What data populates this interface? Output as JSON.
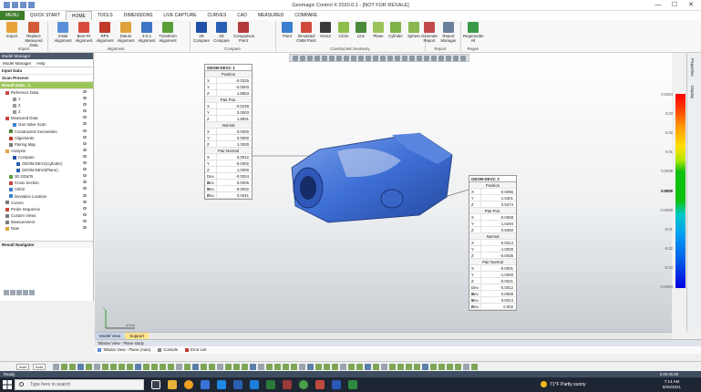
{
  "window": {
    "title": "Geomagic Control X 2020.0.1 - [NOT FOR RESALE]",
    "minimize": "—",
    "maximize": "☐",
    "close": "✕"
  },
  "ribbon_tabs": [
    {
      "label": "MENU"
    },
    {
      "label": "QUICK START"
    },
    {
      "label": "HOME"
    },
    {
      "label": "TOOLS"
    },
    {
      "label": "DIMENSIONS"
    },
    {
      "label": "LIVE CAPTURE"
    },
    {
      "label": "CURVES"
    },
    {
      "label": "CAD"
    },
    {
      "label": "MEASURED"
    },
    {
      "label": "COMPARE"
    }
  ],
  "ribbon": {
    "import": {
      "buttons": [
        {
          "label": "Import",
          "color": "#e8a23a"
        },
        {
          "label": "Replace Measured Data",
          "color": "#d25a3a"
        }
      ],
      "group": "Import"
    },
    "alignment": {
      "buttons": [
        {
          "label": "Initial Alignment",
          "color": "#5a8fd8"
        },
        {
          "label": "Best-Fit Alignment",
          "color": "#d94c3d"
        },
        {
          "label": "RPS Alignment",
          "color": "#c0392b"
        },
        {
          "label": "Datum Alignment",
          "color": "#e0a33a"
        },
        {
          "label": "3-2-1 Alignment",
          "color": "#3e74c4"
        },
        {
          "label": "Transform Alignment",
          "color": "#5a9e3a"
        }
      ],
      "group": "Alignment"
    },
    "compare": {
      "buttons": [
        {
          "label": "3D Compare",
          "color": "#1f4fa8"
        },
        {
          "label": "2D Compare",
          "color": "#2b5fb3"
        },
        {
          "label": "Comparison Point",
          "color": "#b33b3b"
        }
      ],
      "group": "Compare"
    },
    "geometry": {
      "buttons": [
        {
          "label": "Point",
          "color": "#3a7fd0"
        },
        {
          "label": "Simulated CMM Point",
          "color": "#d04a3a"
        },
        {
          "label": "Vector",
          "color": "#3a3a3a"
        },
        {
          "label": "Circle",
          "color": "#8fbf4a"
        },
        {
          "label": "Line",
          "color": "#4a8a3a"
        },
        {
          "label": "Plane",
          "color": "#9bc25a"
        },
        {
          "label": "Cylinder",
          "color": "#7fb247"
        },
        {
          "label": "Sphere",
          "color": "#88b84e"
        }
      ],
      "group": "Constructed Geometry"
    },
    "report": {
      "buttons": [
        {
          "label": "Generate Report",
          "color": "#c24a4a"
        },
        {
          "label": "Report Manager",
          "color": "#6a7f9a"
        }
      ],
      "group": "Report"
    },
    "regen": {
      "buttons": [
        {
          "label": "Regenerate All",
          "color": "#3a9a4a"
        }
      ],
      "group": "Regen"
    }
  },
  "panel": {
    "title": "Model Manager",
    "tabs": [
      "Model Manager",
      "Help"
    ],
    "sections": {
      "input": "Input Data",
      "scan": "Scan Process",
      "result": "Result Data - 1"
    },
    "tree": [
      {
        "label": "Reference Data",
        "indent": 1,
        "color": "#c44"
      },
      {
        "label": "1",
        "indent": 3,
        "color": "#999"
      },
      {
        "label": "2",
        "indent": 3,
        "color": "#999"
      },
      {
        "label": "3",
        "indent": 3,
        "color": "#999"
      },
      {
        "label": "Measured Data",
        "indent": 1,
        "color": "#c44"
      },
      {
        "label": "Gas Valve Scan",
        "indent": 3,
        "color": "#3a7fd0"
      },
      {
        "label": "Constructed Geometries",
        "indent": 2,
        "color": "#4a8a3a"
      },
      {
        "label": "Alignments",
        "indent": 2,
        "color": "#c0392b"
      },
      {
        "label": "Pairing Map",
        "indent": 2,
        "color": "#7a7a7a"
      },
      {
        "label": "Analysis",
        "indent": 1,
        "color": "#e0a33a"
      },
      {
        "label": "Compare",
        "indent": 3,
        "color": "#1f4fa8"
      },
      {
        "label": "GEOM-DEV1(Cylinder)",
        "indent": 4,
        "color": "#2b5fb3"
      },
      {
        "label": "GEOM-DEV2(Plane)",
        "indent": 4,
        "color": "#2b5fb3"
      },
      {
        "label": "3D GD&Ts",
        "indent": 2,
        "color": "#5a9e3a"
      },
      {
        "label": "Cross Section",
        "indent": 2,
        "color": "#c44"
      },
      {
        "label": "Airfoil",
        "indent": 2,
        "color": "#3a7fd0"
      },
      {
        "label": "Deviation Location",
        "indent": 2,
        "color": "#3a7fd0"
      },
      {
        "label": "Curves",
        "indent": 1,
        "color": "#7a7a7a"
      },
      {
        "label": "Probe Sequence",
        "indent": 1,
        "color": "#d04a3a"
      },
      {
        "label": "Custom Views",
        "indent": 1,
        "color": "#7a7a7a"
      },
      {
        "label": "Measurement",
        "indent": 1,
        "color": "#7a7a7a"
      },
      {
        "label": "Note",
        "indent": 1,
        "color": "#e0a33a"
      }
    ],
    "navigator": "Result Navigator"
  },
  "callout1": {
    "title": "GEOM-DEV2: 1",
    "rows": [
      {
        "k": "",
        "v": "Position",
        "sub": true
      },
      {
        "k": "X",
        "v": "-0.0225"
      },
      {
        "k": "Y",
        "v": "-0.0003"
      },
      {
        "k": "Z",
        "v": "1.8853"
      },
      {
        "k": "",
        "v": "Pair Pos.",
        "sub": true
      },
      {
        "k": "X",
        "v": "-0.0249"
      },
      {
        "k": "Y",
        "v": "0.0003"
      },
      {
        "k": "Z",
        "v": "1.8831"
      },
      {
        "k": "",
        "v": "Normal",
        "sub": true
      },
      {
        "k": "X",
        "v": "0.0000"
      },
      {
        "k": "Y",
        "v": "0.0000"
      },
      {
        "k": "Z",
        "v": "1.0000"
      },
      {
        "k": "",
        "v": "Pair Normal",
        "sub": true
      },
      {
        "k": "X",
        "v": "0.0012"
      },
      {
        "k": "Y",
        "v": "-0.0002"
      },
      {
        "k": "Z",
        "v": "1.0000"
      },
      {
        "k": "Dev. X",
        "v": "-0.0024"
      },
      {
        "k": "Dev. Y",
        "v": "0.0006"
      },
      {
        "k": "Dev. Z",
        "v": "-0.0022"
      },
      {
        "k": "Dev.",
        "v": "0.0041"
      }
    ]
  },
  "callout2": {
    "title": "GEOM-DEV2: 2",
    "rows": [
      {
        "k": "",
        "v": "Position",
        "sub": true
      },
      {
        "k": "X",
        "v": "-0.0056"
      },
      {
        "k": "Y",
        "v": "-1.6301"
      },
      {
        "k": "Z",
        "v": "0.5374"
      },
      {
        "k": "",
        "v": "Pair Pos.",
        "sub": true
      },
      {
        "k": "X",
        "v": "-0.0068"
      },
      {
        "k": "Y",
        "v": "-1.6294"
      },
      {
        "k": "Z",
        "v": "0.5360"
      },
      {
        "k": "",
        "v": "Normal",
        "sub": true
      },
      {
        "k": "X",
        "v": "-0.0014"
      },
      {
        "k": "Y",
        "v": "-1.0000"
      },
      {
        "k": "Z",
        "v": "-0.0036"
      },
      {
        "k": "",
        "v": "Pair Normal",
        "sub": true
      },
      {
        "k": "X",
        "v": "-0.0001"
      },
      {
        "k": "Y",
        "v": "-1.0000"
      },
      {
        "k": "Z",
        "v": "-0.0021"
      },
      {
        "k": "Dev. X",
        "v": "-0.0012"
      },
      {
        "k": "Dev. Y",
        "v": "0.0008"
      },
      {
        "k": "Dev. Z",
        "v": "0.0014"
      },
      {
        "k": "Dev.",
        "v": "0.002"
      }
    ]
  },
  "legend": {
    "ticks": [
      "0.0394",
      "0.03",
      "0.02",
      "0.01",
      "0.0039",
      "0.0000",
      "-0.0039",
      "-0.01",
      "-0.02",
      "-0.03",
      "-0.0394"
    ],
    "highlight": "0.0000"
  },
  "scale_label": "1.0 in",
  "axis": {
    "x": "X",
    "y": "Y"
  },
  "viewport_tabs": [
    {
      "label": "Model View"
    },
    {
      "label": "Support"
    }
  ],
  "tabular": {
    "title": "Tabular View - Plane study",
    "items": [
      {
        "label": "Tabular View - Plane (Auto)",
        "color": "#5a8fd8"
      },
      {
        "label": "Console",
        "color": "#888"
      },
      {
        "label": "Error List",
        "color": "#c0392b"
      }
    ]
  },
  "side_tabs": [
    "Properties",
    "Display"
  ],
  "bottom_toolbar": {
    "select1": "Auto",
    "select2": "Auto"
  },
  "status": {
    "left": "Ready",
    "right": "0.00 00.00"
  },
  "taskbar": {
    "search_placeholder": "Type here to search",
    "weather": "71°F  Partly sunny",
    "time": "7:14 AM",
    "date": "8/26/2021"
  }
}
